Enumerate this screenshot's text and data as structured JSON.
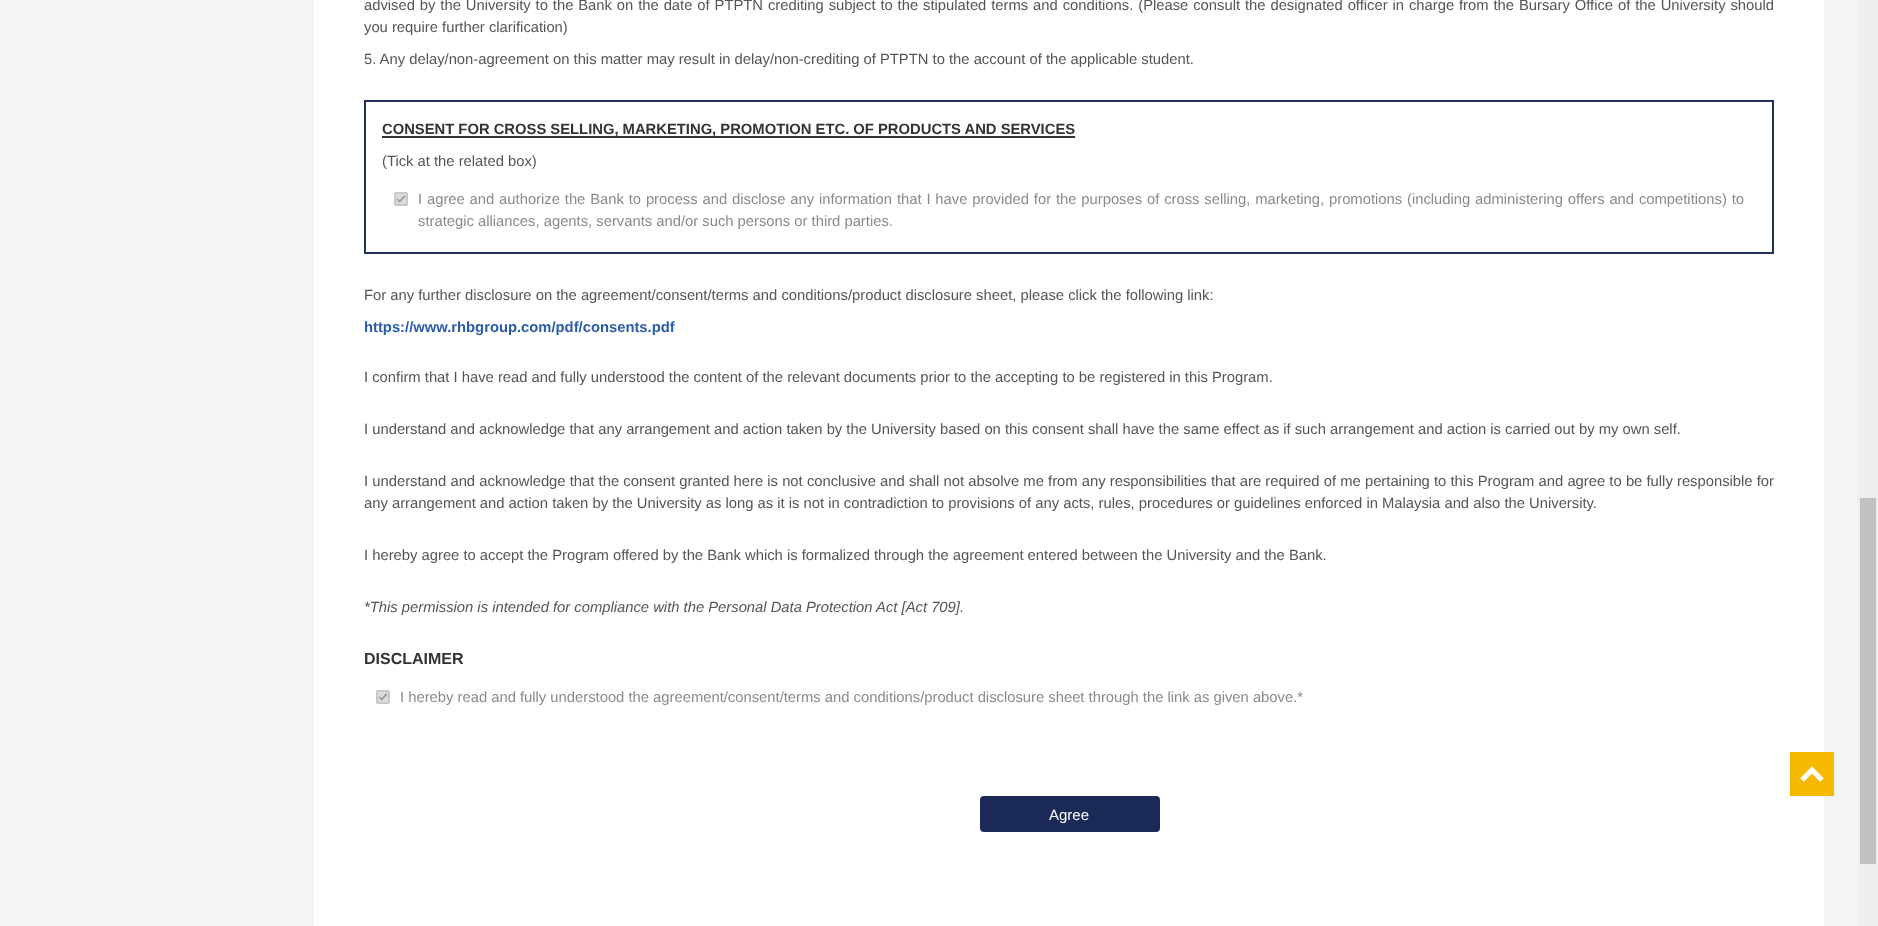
{
  "intro_paragraphs": [
    "advised by the University to the Bank on the date of PTPTN crediting subject to the stipulated terms and conditions. (Please consult the designated officer in charge from the Bursary Office of the University should you require further clarification)",
    "5. Any delay/non-agreement on this matter may result in delay/non-crediting of PTPTN to the account of the applicable student."
  ],
  "consent_box": {
    "title": "CONSENT FOR CROSS SELLING, MARKETING, PROMOTION ETC. OF PRODUCTS AND SERVICES",
    "hint": "(Tick at the related box)",
    "checkbox": {
      "label": "I agree and authorize the Bank to process and disclose any information that I have provided for the purposes of cross selling, marketing, promotions (including administering offers and competitions) to strategic alliances, agents, servants and/or such persons or third parties.",
      "checked": true,
      "disabled": true
    }
  },
  "disclosure_text": "For any further disclosure on the agreement/consent/terms and conditions/product disclosure sheet, please click the following link:",
  "link": "https://www.rhbgroup.com/pdf/consents.pdf",
  "statements": [
    "I confirm that I have read and fully understood the content of the relevant documents prior to the accepting to be registered in this Program.",
    "I understand and acknowledge that any arrangement and action taken by the University based on this consent shall have the same effect as if such arrangement and action is carried out by my own self.",
    "I understand and acknowledge that the consent granted here is not conclusive and shall not absolve me from any responsibilities that are required of me pertaining to this Program and agree to be fully responsible for any arrangement and action taken by the University as long as it is not in contradiction to provisions of any acts, rules, procedures or guidelines enforced in Malaysia and also the University.",
    "I hereby agree to accept the Program offered by the Bank which is formalized through the agreement entered between the University and the Bank."
  ],
  "note": "*This permission is intended for compliance with the Personal Data Protection Act [Act 709].",
  "disclaimer": {
    "title": "DISCLAIMER",
    "checkbox": {
      "label": "I hereby read and fully understood the agreement/consent/terms and conditions/product disclosure sheet through the link as given above.*",
      "checked": true,
      "disabled": true
    }
  },
  "agree_button": "Agree"
}
